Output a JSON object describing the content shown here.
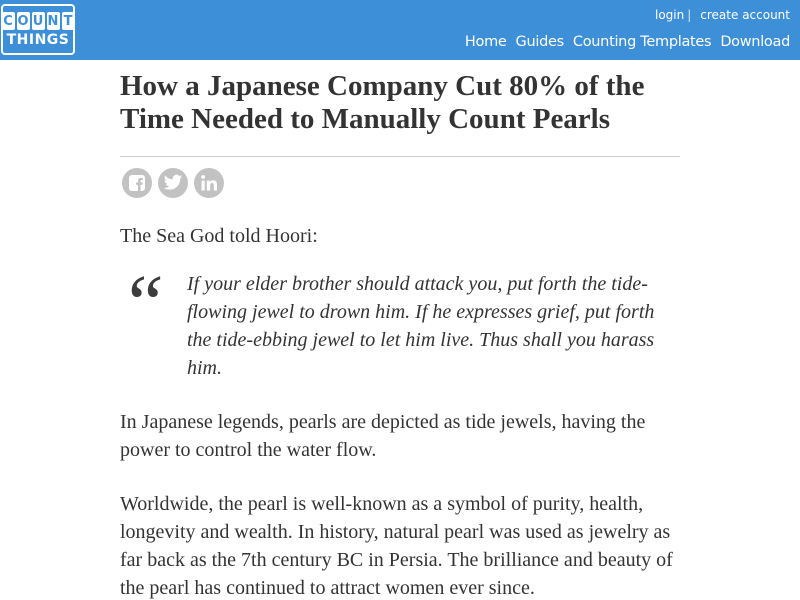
{
  "header": {
    "logo": {
      "top_letters": [
        "C",
        "O",
        "U",
        "N",
        "T"
      ],
      "bottom_text": "THINGS"
    },
    "account": {
      "login": "login",
      "separator": "|",
      "create_account": "create account"
    },
    "nav": [
      {
        "label": "Home"
      },
      {
        "label": "Guides"
      },
      {
        "label": "Counting Templates"
      },
      {
        "label": "Download"
      }
    ]
  },
  "article": {
    "title": "How a Japanese Company Cut 80% of the Time Needed to Manually Count Pearls",
    "share": [
      {
        "icon": "facebook-icon"
      },
      {
        "icon": "twitter-icon"
      },
      {
        "icon": "linkedin-icon"
      }
    ],
    "intro": "The Sea God told Hoori:",
    "quote_mark": "“",
    "quote": "If your elder brother should attack you, put forth the tide-flowing jewel to drown him. If he expresses grief, put forth the tide-ebbing jewel to let him live. Thus shall you harass him.",
    "paragraphs": [
      "In Japanese legends, pearls are depicted as tide jewels, having the power to control the water flow.",
      "Worldwide, the pearl is well-known as a symbol of purity, health, longevity and wealth. In history, natural pearl was used as jewelry as far back as the 7th century BC in Persia. The brilliance and beauty of the pearl has continued to attract women ever since."
    ]
  },
  "colors": {
    "header_bg": "#3d8fd8",
    "share_icon_bg": "#c2c2c2",
    "text": "#333333"
  }
}
